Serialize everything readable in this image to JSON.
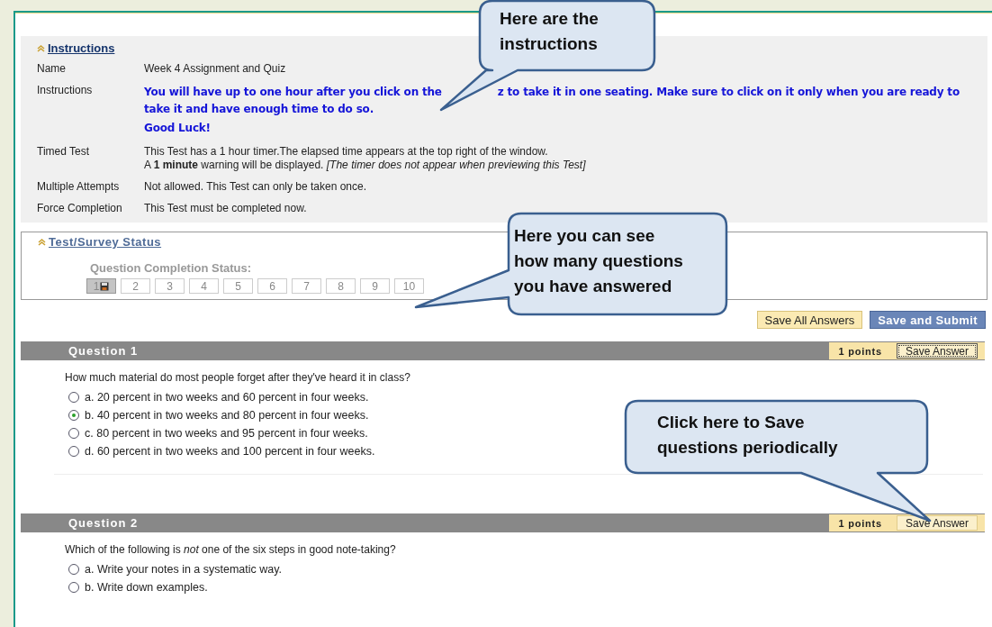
{
  "instructions": {
    "heading": "Instructions",
    "rows": [
      {
        "label": "Name",
        "kind": "plain",
        "lines": [
          "Week 4 Assignment and Quiz"
        ]
      },
      {
        "label": "Instructions",
        "kind": "notice",
        "paragraphs": [
          [
            "You will have up to one hour after you click on the",
            "z to take it in one seating. Make sure to click on it only when you are ready to take it and have enough time to do so."
          ],
          [
            "Good Luck!"
          ]
        ]
      },
      {
        "label": "Timed Test",
        "kind": "plain",
        "lines": [
          "This Test has a 1 hour timer.The elapsed time appears at the top right of the window.",
          "A **1 minute** warning will be displayed. *[The timer does not appear when previewing this Test]*"
        ]
      },
      {
        "label": "Multiple Attempts",
        "kind": "plain",
        "lines": [
          "Not allowed. This Test can only be taken once."
        ]
      },
      {
        "label": "Force Completion",
        "kind": "plain",
        "lines": [
          "This Test must be completed now."
        ]
      }
    ]
  },
  "status": {
    "heading": "Test/Survey Status",
    "caption": "Question Completion Status:",
    "questions": [
      {
        "label": "1",
        "answered": true
      },
      {
        "label": "2",
        "answered": false
      },
      {
        "label": "3",
        "answered": false
      },
      {
        "label": "4",
        "answered": false
      },
      {
        "label": "5",
        "answered": false
      },
      {
        "label": "6",
        "answered": false
      },
      {
        "label": "7",
        "answered": false
      },
      {
        "label": "8",
        "answered": false
      },
      {
        "label": "9",
        "answered": false
      },
      {
        "label": "10",
        "answered": false
      }
    ]
  },
  "actions": [
    {
      "label": "Save All Answers",
      "kind": "secondary"
    },
    {
      "label": "Save and Submit",
      "kind": "primary"
    }
  ],
  "questions": [
    {
      "title": "Question 1",
      "points": "1 points",
      "save_label": "Save Answer",
      "focused": true,
      "prompt": "How much material do most people forget after they've heard it in class?",
      "choices": [
        {
          "label": "a. 20 percent in two weeks and 60 percent in four weeks.",
          "selected": false
        },
        {
          "label": "b. 40 percent in two weeks and 80 percent in four weeks.",
          "selected": true
        },
        {
          "label": "c. 80 percent in two weeks and 95 percent in four weeks.",
          "selected": false
        },
        {
          "label": "d. 60 percent in two weeks and 100 percent in four weeks.",
          "selected": false
        }
      ]
    },
    {
      "title": "Question 2",
      "points": "1 points",
      "save_label": "Save Answer",
      "focused": false,
      "prompt": "Which of the following is *not* one of the six steps in good note-taking?",
      "choices": [
        {
          "label": "a. Write your notes in a systematic way.",
          "selected": false
        },
        {
          "label": "b. Write down examples.",
          "selected": false
        }
      ]
    }
  ],
  "callouts": [
    {
      "lines": [
        "Here are the",
        "instructions"
      ]
    },
    {
      "lines": [
        "Here you can see",
        "how many questions",
        "you have answered"
      ]
    },
    {
      "lines": [
        "Click here to Save",
        "questions periodically"
      ]
    }
  ]
}
